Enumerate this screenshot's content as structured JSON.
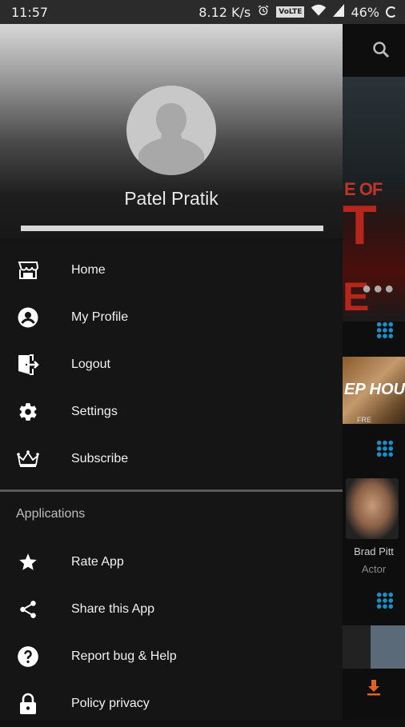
{
  "status_bar": {
    "time": "11:57",
    "speed": "8.12 K/s",
    "network_badge": "VoLTE",
    "battery": "46%"
  },
  "drawer": {
    "user_name": "Patel Pratik",
    "menu": [
      {
        "label": "Home",
        "icon": "store-icon"
      },
      {
        "label": "My Profile",
        "icon": "account-circle-icon"
      },
      {
        "label": "Logout",
        "icon": "exit-door-icon"
      },
      {
        "label": "Settings",
        "icon": "gear-icon"
      },
      {
        "label": "Subscribe",
        "icon": "crown-icon"
      }
    ],
    "section_title": "Applications",
    "apps": [
      {
        "label": "Rate App",
        "icon": "star-icon"
      },
      {
        "label": "Share this App",
        "icon": "share-icon"
      },
      {
        "label": "Report bug & Help",
        "icon": "help-circle-icon"
      },
      {
        "label": "Policy privacy",
        "icon": "lock-icon"
      }
    ]
  },
  "background": {
    "poster1_text": [
      "E OF",
      "T",
      "E"
    ],
    "poster2_title": "EP HOUS",
    "poster2_sub": "FRE",
    "actor_name": "Brad Pitt",
    "actor_role": "Actor"
  },
  "colors": {
    "drawer_bg": "#151515",
    "accent_blue": "#1e8fc6",
    "download_orange": "#e0631f"
  }
}
